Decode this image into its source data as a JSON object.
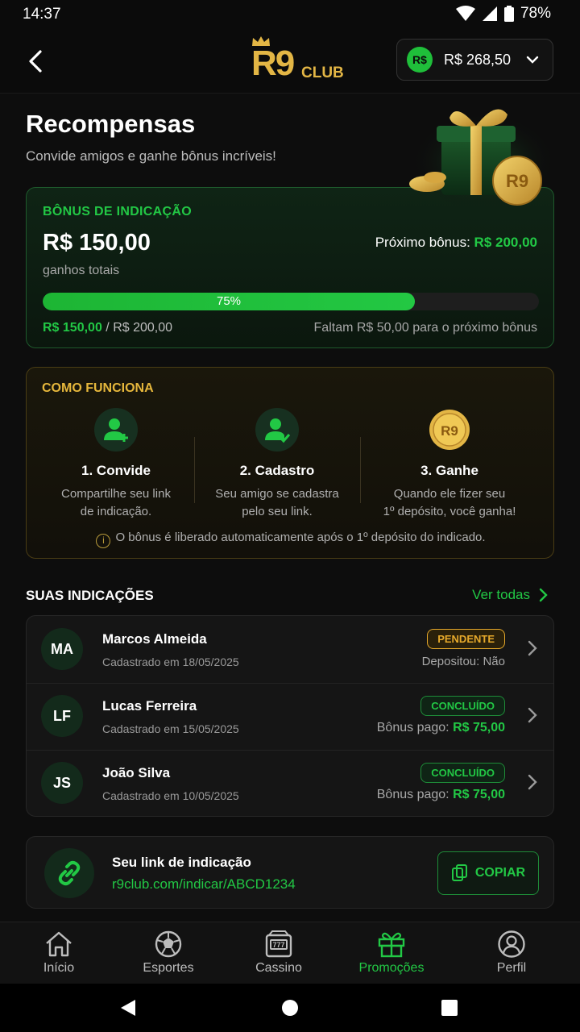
{
  "status": {
    "time": "14:37",
    "battery": "78%"
  },
  "header": {
    "logo_main": "R9",
    "logo_sub": "CLUB",
    "currency": "R$",
    "balance": "R$ 268,50"
  },
  "page": {
    "title": "Recompensas",
    "subtitle": "Convide amigos e ganhe bônus incríveis!"
  },
  "bonus": {
    "label": "BÔNUS DE INDICAÇÃO",
    "total": "R$ 150,00",
    "total_caption": "ganhos totais",
    "next_label": "Próximo bônus:",
    "next_value": "R$ 200,00",
    "progress_percent": 75,
    "progress_label": "75%",
    "current": "R$ 150,00",
    "target": "/ R$ 200,00",
    "remaining": "Faltam R$ 50,00 para o próximo bônus"
  },
  "how": {
    "title": "COMO FUNCIONA",
    "steps": [
      {
        "title": "1. Convide",
        "line1": "Compartilhe seu link",
        "line2": "de indicação."
      },
      {
        "title": "2. Cadastro",
        "line1": "Seu amigo se cadastra",
        "line2": "pelo seu link."
      },
      {
        "title": "3. Ganhe",
        "line1": "Quando ele fizer seu",
        "line2": "1º depósito, você ganha!"
      }
    ],
    "coin_text": "R9",
    "note": "O bônus é liberado automaticamente após o 1º depósito do indicado."
  },
  "referrals": {
    "title": "SUAS INDICAÇÕES",
    "see_all": "Ver todas",
    "items": [
      {
        "initials": "MA",
        "name": "Marcos Almeida",
        "date": "Cadastrado em 18/05/2025",
        "status": "PENDENTE",
        "info": "Depositou: Não",
        "info_value": ""
      },
      {
        "initials": "LF",
        "name": "Lucas Ferreira",
        "date": "Cadastrado em 15/05/2025",
        "status": "CONCLUÍDO",
        "info": "Bônus pago:",
        "info_value": "R$ 75,00"
      },
      {
        "initials": "JS",
        "name": "João Silva",
        "date": "Cadastrado em 10/05/2025",
        "status": "CONCLUÍDO",
        "info": "Bônus pago:",
        "info_value": "R$ 75,00"
      }
    ]
  },
  "link": {
    "title": "Seu link de indicação",
    "url": "r9club.com/indicar/ABCD1234",
    "copy_label": "COPIAR"
  },
  "nav": {
    "items": [
      {
        "label": "Início"
      },
      {
        "label": "Esportes"
      },
      {
        "label": "Cassino"
      },
      {
        "label": "Promoções"
      },
      {
        "label": "Perfil"
      }
    ],
    "active_index": 3
  },
  "colors": {
    "accent_green": "#22c845",
    "gold": "#e6b73c",
    "pending": "#e6a92b"
  }
}
